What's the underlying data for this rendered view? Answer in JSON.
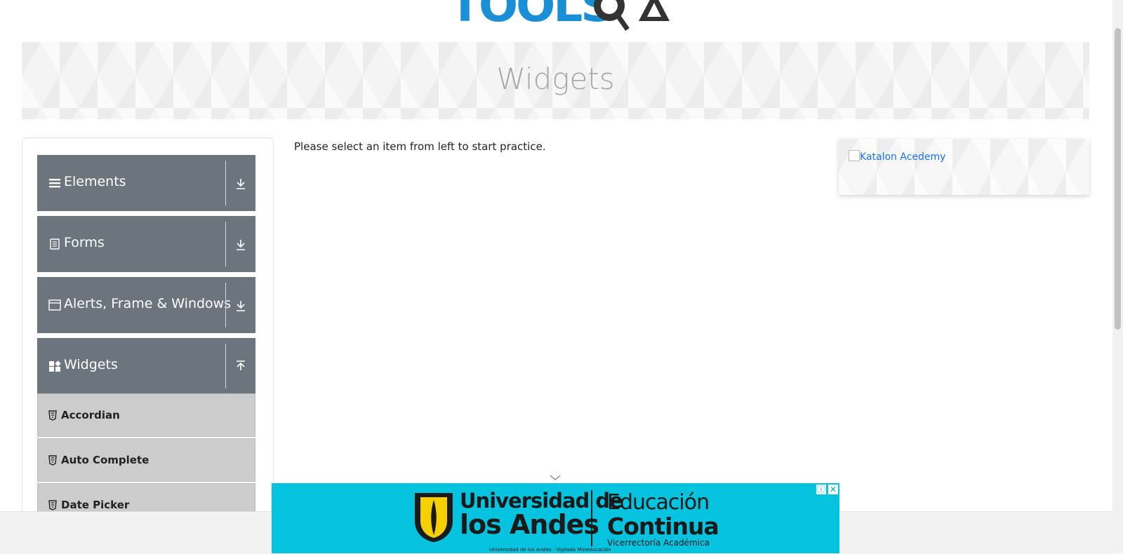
{
  "header": {
    "logo_text": "TOOLSQA"
  },
  "banner": {
    "title": "Widgets"
  },
  "sidebar": {
    "groups": [
      {
        "label": "Elements",
        "icon": "hamburger-icon",
        "toggle": "download-arrow-icon"
      },
      {
        "label": "Forms",
        "icon": "document-icon",
        "toggle": "download-arrow-icon"
      },
      {
        "label": "Alerts, Frame & Windows",
        "icon": "window-icon",
        "toggle": "download-arrow-icon"
      },
      {
        "label": "Widgets",
        "icon": "widgets-icon",
        "toggle": "upload-arrow-icon"
      }
    ],
    "widget_items": [
      {
        "label": "Accordian",
        "icon": "html5-icon"
      },
      {
        "label": "Auto Complete",
        "icon": "html5-icon"
      },
      {
        "label": "Date Picker",
        "icon": "html5-icon"
      }
    ]
  },
  "main": {
    "hint": "Please select an item from left to start practice."
  },
  "promo": {
    "alt_text": "Katalon Acedemy"
  },
  "ad": {
    "university_line1": "Universidad de",
    "university_line2": "los Andes",
    "educacion": "Educación",
    "continua": "Continua",
    "vicerrectoria": "Vicerrectoría Académica",
    "fine_print": "Universidad de los Andes · Vigilada Mineducación",
    "colors": {
      "background": "#04c3de"
    }
  },
  "colors": {
    "accent_blue": "#1a8fd6",
    "sidebar_header": "#6c757d",
    "menu_item": "#cccccc"
  }
}
